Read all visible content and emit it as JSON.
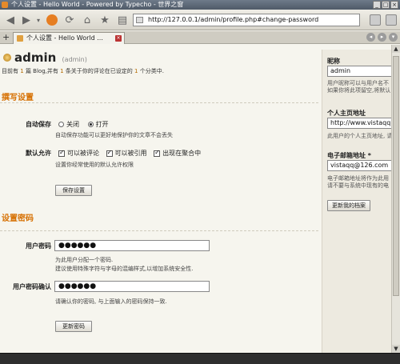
{
  "window": {
    "title": "个人设置 - Hello World - Powered by Typecho - 世界之窗",
    "buttons": [
      "_",
      "□",
      "×"
    ]
  },
  "toolbar": {
    "url": "http://127.0.0.1/admin/profile.php#change-password"
  },
  "tabs": [
    {
      "label": "个人设置 - Hello World ...",
      "active": true
    }
  ],
  "tab_new": "+",
  "tab_controls": [
    "◂",
    "▸",
    "▾"
  ],
  "profile": {
    "name": "admin",
    "username": "(admin)",
    "stats_prefix": "目前有",
    "post_count": "1",
    "stats_mid1": "篇 Blog,并有",
    "comment_count": "1",
    "stats_mid2": "条关于你的评论在已设定的",
    "category_count": "1",
    "stats_suffix": "个分类中."
  },
  "writing": {
    "title": "撰写设置",
    "autosave_label": "自动保存",
    "autosave_off": "关闭",
    "autosave_on": "打开",
    "autosave_selected": "打开",
    "autosave_hint": "自动保存功能可以更好地保护你的文章不会丢失",
    "default_allow_label": "默认允许",
    "allow_comment": "可以被评论",
    "allow_ping": "可以被引用",
    "allow_feed": "出现在聚合中",
    "default_allow_hint": "设置你经常使用的默认允许权限",
    "save_button": "保存设置"
  },
  "password": {
    "title": "设置密码",
    "password_label": "用户密码",
    "password_value": "●●●●●●",
    "password_hint_1": "为此用户分配一个密码.",
    "password_hint_2": "建议使用特殊字符与字母的混编样式,以增加系统安全性.",
    "confirm_label": "用户密码确认",
    "confirm_value": "●●●●●●",
    "confirm_hint": "请确认你的密码, 与上面输入的密码保持一致.",
    "update_button": "更新密码"
  },
  "sidebar": {
    "nickname_label": "昵称",
    "nickname_value": "admin",
    "nickname_hint_1": "用户昵称可以与用户名不",
    "nickname_hint_2": "如果你将此项留空,将默认",
    "homepage_label": "个人主页地址",
    "homepage_value": "http://www.vistaqq",
    "homepage_hint": "此用户的个人主页地址, 请",
    "email_label": "电子邮箱地址 *",
    "email_value": "vistaqq@126.com",
    "email_hint_1": "电子邮箱地址将作为此用",
    "email_hint_2": "请不要与系统中现有的电",
    "update_profile_button": "更新我的档案"
  }
}
